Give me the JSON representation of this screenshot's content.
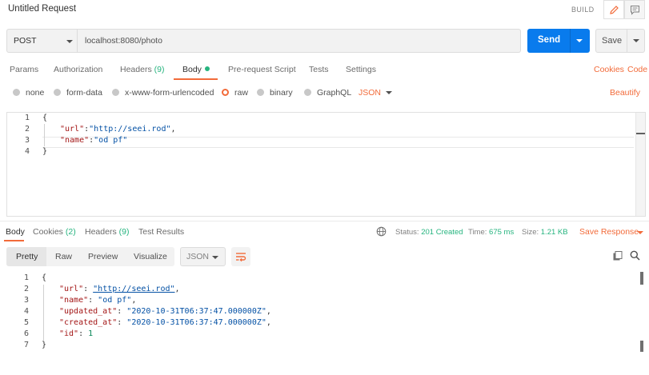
{
  "title": "Untitled Request",
  "build_label": "BUILD",
  "icons": {
    "edit": "pencil-icon",
    "comments": "comment-icon"
  },
  "request": {
    "method": "POST",
    "url": "localhost:8080/photo",
    "send_label": "Send",
    "save_label": "Save"
  },
  "request_tabs": [
    {
      "label": "Params"
    },
    {
      "label": "Authorization"
    },
    {
      "label": "Headers",
      "count": "(9)"
    },
    {
      "label": "Body",
      "active": true
    },
    {
      "label": "Pre-request Script"
    },
    {
      "label": "Tests"
    },
    {
      "label": "Settings"
    }
  ],
  "right_links": {
    "cookies": "Cookies",
    "code": "Code"
  },
  "body_types": [
    "none",
    "form-data",
    "x-www-form-urlencoded",
    "raw",
    "binary",
    "GraphQL"
  ],
  "body_type_selected": "raw",
  "body_format": "JSON",
  "beautify_label": "Beautify",
  "request_body": {
    "line_numbers": [
      "1",
      "2",
      "3",
      "4"
    ],
    "lines": [
      "{",
      "\"url\"",
      ":",
      "\"http://seei.rod\"",
      ",",
      "\"name\"",
      ":",
      "\"od pf\"",
      "}"
    ]
  },
  "response_tabs": [
    {
      "label": "Body",
      "active": true
    },
    {
      "label": "Cookies",
      "count": "(2)"
    },
    {
      "label": "Headers",
      "count": "(9)"
    },
    {
      "label": "Test Results"
    }
  ],
  "status": {
    "status_label": "Status:",
    "status_value": "201 Created",
    "time_label": "Time:",
    "time_value": "675 ms",
    "size_label": "Size:",
    "size_value": "1.21 KB"
  },
  "save_response_label": "Save Response",
  "view_modes": [
    "Pretty",
    "Raw",
    "Preview",
    "Visualize"
  ],
  "view_mode_selected": "Pretty",
  "response_format": "JSON",
  "response_body": {
    "line_numbers": [
      "1",
      "2",
      "3",
      "4",
      "5",
      "6",
      "7"
    ],
    "fields": [
      {
        "key": "\"url\"",
        "value": "\"http://seei.rod\""
      },
      {
        "key": "\"name\"",
        "value": "\"od pf\""
      },
      {
        "key": "\"updated_at\"",
        "value": "\"2020-10-31T06:37:47.000000Z\""
      },
      {
        "key": "\"created_at\"",
        "value": "\"2020-10-31T06:37:47.000000Z\""
      },
      {
        "key": "\"id\"",
        "value": "1"
      }
    ],
    "open_brace": "{",
    "close_brace": "}"
  },
  "colors": {
    "accent": "#f26b3a",
    "send": "#097bed",
    "success": "#26b47f"
  }
}
